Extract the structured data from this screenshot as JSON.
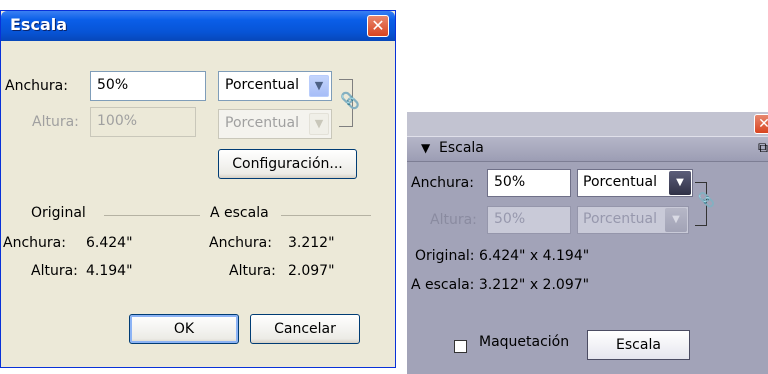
{
  "dialog": {
    "title": "Escala",
    "close_symbol": "✕",
    "width_label": "Anchura:",
    "width_value": "50%",
    "width_unit": "Porcentual",
    "height_label": "Altura:",
    "height_value": "100%",
    "height_unit": "Porcentual",
    "settings_button": "Configuración...",
    "original_heading": "Original",
    "scaled_heading": "A escala",
    "original_width_label": "Anchura:",
    "original_width_value": "6.424\"",
    "original_height_label": "Altura:",
    "original_height_value": "4.194\"",
    "scaled_width_label": "Anchura:",
    "scaled_width_value": "3.212\"",
    "scaled_height_label": "Altura:",
    "scaled_height_value": "2.097\"",
    "ok_button": "OK",
    "cancel_button": "Cancelar"
  },
  "panel": {
    "close_symbol": "✕",
    "collapse_symbol": "▼",
    "title": "Escala",
    "menu_symbol": "⧉",
    "width_label": "Anchura:",
    "width_value": "50%",
    "width_unit": "Porcentual",
    "height_label": "Altura:",
    "height_value": "50%",
    "height_unit": "Porcentual",
    "original_text": "Original: 6.424\" x 4.194\"",
    "scaled_text": "A escala: 3.212\" x 2.097\"",
    "layout_checkbox_label": "Maquetación",
    "layout_checked": false,
    "scale_button": "Escala"
  },
  "icons": {
    "dropdown_arrow": "▼",
    "chain_link": "🔗"
  },
  "colors": {
    "xp_title_blue": "#0754d6",
    "dialog_bg": "#ece9d8",
    "close_red": "#d84420",
    "panel_bg": "#a2a3b8"
  }
}
